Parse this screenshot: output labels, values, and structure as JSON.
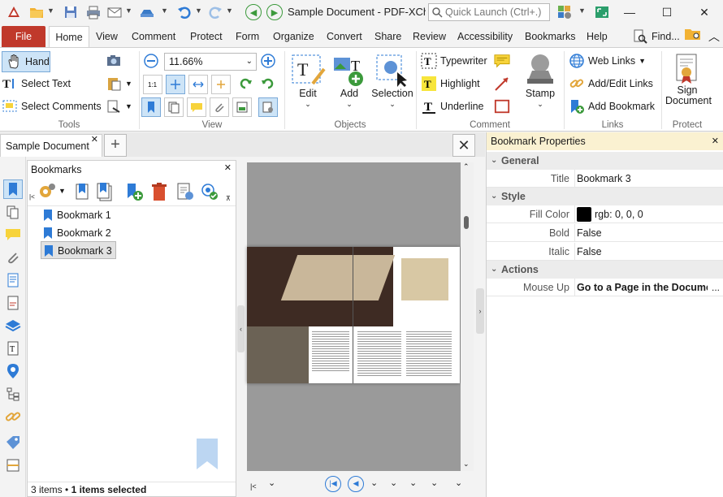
{
  "window": {
    "title": "Sample Document - PDF-XCha...",
    "quick_launch_placeholder": "Quick Launch (Ctrl+.)"
  },
  "ribbon_tabs": [
    "File",
    "Home",
    "View",
    "Comment",
    "Protect",
    "Form",
    "Organize",
    "Convert",
    "Share",
    "Review",
    "Accessibility",
    "Bookmarks",
    "Help"
  ],
  "find_label": "Find...",
  "ribbon": {
    "tools": {
      "group": "Tools",
      "hand": "Hand",
      "select_text": "Select Text",
      "select_comments": "Select Comments"
    },
    "view": {
      "group": "View",
      "zoom": "11.66%"
    },
    "objects": {
      "group": "Objects",
      "edit": "Edit",
      "add": "Add",
      "selection": "Selection"
    },
    "comment": {
      "group": "Comment",
      "typewriter": "Typewriter",
      "highlight": "Highlight",
      "underline": "Underline",
      "stamp": "Stamp"
    },
    "links": {
      "group": "Links",
      "web_links": "Web Links",
      "add_edit_links": "Add/Edit Links",
      "add_bookmark": "Add Bookmark"
    },
    "protect": {
      "group": "Protect",
      "sign_document": "Sign Document"
    }
  },
  "document_tab": "Sample Document",
  "bookmarks_panel": {
    "title": "Bookmarks",
    "items": [
      "Bookmark 1",
      "Bookmark 2",
      "Bookmark 3"
    ],
    "selected_index": 2,
    "status_count": "3 items",
    "status_selected": "1 items selected"
  },
  "properties_panel": {
    "title": "Bookmark Properties",
    "sections": {
      "general": "General",
      "style": "Style",
      "actions": "Actions"
    },
    "rows": {
      "title": {
        "label": "Title",
        "value": "Bookmark 3"
      },
      "fill_color": {
        "label": "Fill Color",
        "value": "rgb: 0, 0, 0",
        "swatch": "#000000"
      },
      "bold": {
        "label": "Bold",
        "value": "False"
      },
      "italic": {
        "label": "Italic",
        "value": "False"
      },
      "mouse_up": {
        "label": "Mouse Up",
        "value": "Go to a Page in the Docume..."
      }
    },
    "more_symbol": "..."
  },
  "colors": {
    "file_tab": "#c0392b",
    "accent_blue": "#2e7bd6",
    "selection_bg": "#cde4f7"
  }
}
